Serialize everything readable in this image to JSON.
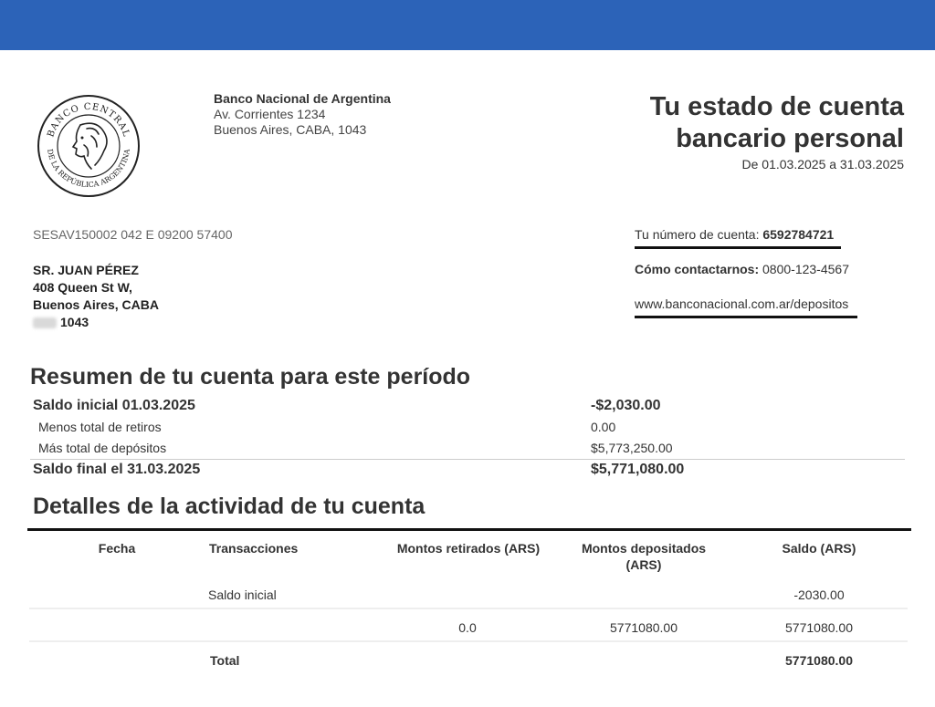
{
  "bank": {
    "name": "Banco Nacional de Argentina",
    "address_line1": "Av. Corrientes 1234",
    "address_line2": "Buenos Aires, CABA, 1043",
    "seal_text_top": "BANCO CENTRAL",
    "seal_text_bottom": "DE LA REPÚBLICA ARGENTINA"
  },
  "statement": {
    "title_line1": "Tu estado de cuenta",
    "title_line2": "bancario personal",
    "period": "De 01.03.2025 a 31.03.2025"
  },
  "reference_code": "SESAV150002 042 E 09200 57400",
  "customer": {
    "name": "SR. JUAN PÉREZ",
    "street": "408 Queen St W,",
    "city": "Buenos Aires, CABA",
    "postal": "1043"
  },
  "contact": {
    "account_label": "Tu número de cuenta:",
    "account_number": "6592784721",
    "contact_label": "Cómo contactarnos:",
    "phone": "0800-123-4567",
    "website": "www.banconacional.com.ar/depositos"
  },
  "summary": {
    "title": "Resumen de tu cuenta para este período",
    "rows": [
      {
        "label": "Saldo inicial 01.03.2025",
        "value": "-$2,030.00"
      },
      {
        "label": "Menos total de retiros",
        "value": "0.00"
      },
      {
        "label": "Más total de depósitos",
        "value": "$5,773,250.00"
      },
      {
        "label": "Saldo final el 31.03.2025",
        "value": "$5,771,080.00"
      }
    ]
  },
  "activity": {
    "title": "Detalles de la actividad de tu cuenta",
    "headers": [
      "Fecha",
      "Transacciones",
      "Montos retirados (ARS)",
      "Montos depositados (ARS)",
      "Saldo (ARS)"
    ],
    "rows": [
      {
        "date": "",
        "transaction": "Saldo inicial",
        "withdrawn": "",
        "deposited": "",
        "balance": "-2030.00"
      },
      {
        "date": "",
        "transaction": "",
        "withdrawn": "0.0",
        "deposited": "5771080.00",
        "balance": "5771080.00"
      }
    ],
    "total_label": "Total",
    "total_balance": "5771080.00"
  },
  "colors": {
    "header_bar": "#2c63b8",
    "text": "#333333"
  }
}
